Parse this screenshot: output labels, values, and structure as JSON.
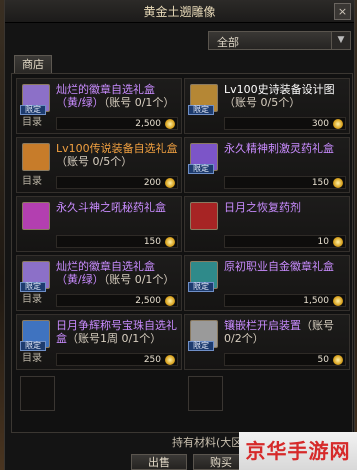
{
  "window": {
    "title": "黄金土遡雕像",
    "close_label": "×"
  },
  "filter": {
    "selected": "全部",
    "arrow": "▼"
  },
  "tabs": {
    "shop": "商店"
  },
  "items": [
    {
      "name": "灿烂的徽章自选礼盒（黄/绿）",
      "limit": "（账号 0/1个）",
      "price": "2,500",
      "menu": "目录",
      "tag": "限定",
      "name_color": "purple",
      "icon_color": "#8c70c8"
    },
    {
      "name": "Lv100史诗装备设计图",
      "limit": "（账号 0/5个）",
      "price": "300",
      "menu": "目录",
      "tag": "限定",
      "name_color": "orange",
      "icon_color": "#b58735"
    },
    {
      "name": "Lv100传说装备自选礼盒",
      "limit": "（账号 0/5个）",
      "price": "200",
      "menu": "目录",
      "tag": "限定",
      "name_color": "orange",
      "icon_color": "#c77c2a"
    },
    {
      "name": "永久精神刺激灵药礼盒",
      "limit": "",
      "price": "150",
      "menu": "目录",
      "tag": "限定",
      "name_color": "purple",
      "icon_color": "#7c55c8"
    },
    {
      "name": "永久斗神之吼秘药礼盒",
      "limit": "",
      "price": "150",
      "menu": "目录",
      "tag": "",
      "name_color": "purple",
      "icon_color": "#b33fb0"
    },
    {
      "name": "日月之恢复药剂",
      "limit": "",
      "price": "10",
      "menu": "",
      "tag": "",
      "name_color": "purple",
      "icon_color": "#a72424"
    },
    {
      "name": "灿烂的徽章自选礼盒（黄/绿）",
      "limit": "（账号 0/1个）",
      "price": "2,500",
      "menu": "目录",
      "tag": "限定",
      "name_color": "purple",
      "icon_color": "#8c70c8"
    },
    {
      "name": "原初职业自金徽章礼盒",
      "limit": "",
      "price": "1,500",
      "menu": "目录",
      "tag": "限定",
      "name_color": "purple",
      "icon_color": "#2f8a8a"
    },
    {
      "name": "日月争辉称号宝珠自选礼盒",
      "limit": "（账号1周 0/1个）",
      "price": "250",
      "menu": "目录",
      "tag": "限定",
      "name_color": "purple",
      "icon_color": "#3f73c0"
    },
    {
      "name": "镶嵌栏开启装置",
      "limit": "（账号 0/2个）",
      "price": "50",
      "menu": "目录",
      "tag": "限定",
      "name_color": "purple",
      "icon_color": "#9a9a9a"
    }
  ],
  "footer": {
    "material_label": "持有材料(大区):",
    "sell_label": "出售",
    "buy_label": "购买"
  },
  "watermark": "京华手游网"
}
